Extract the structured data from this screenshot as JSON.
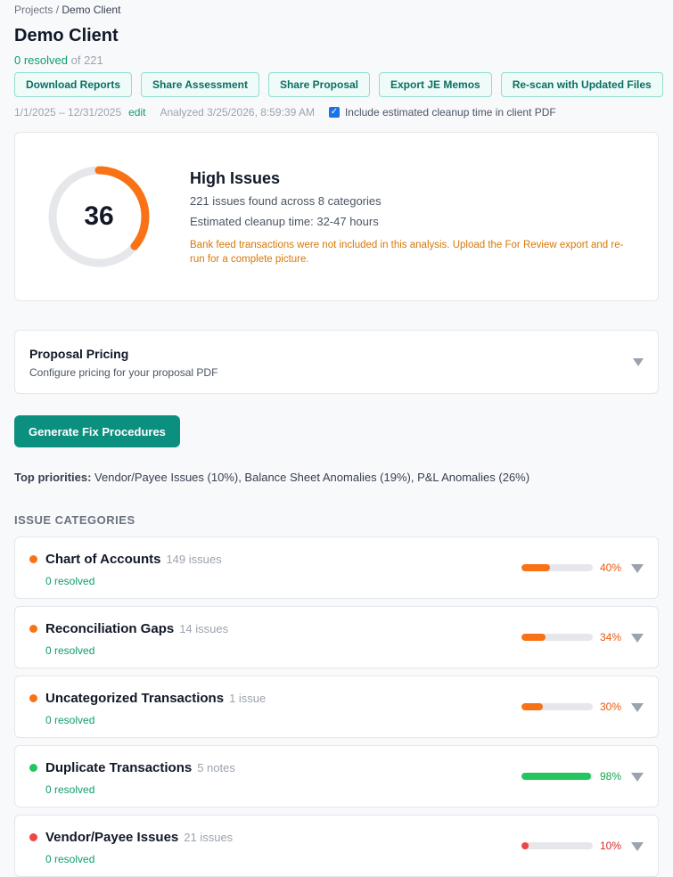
{
  "breadcrumb": {
    "root": "Projects",
    "separator": " / ",
    "current": "Demo Client"
  },
  "page": {
    "title": "Demo Client",
    "resolved_text": "0 resolved",
    "of_text": "of 221"
  },
  "actions": [
    {
      "label": "Download Reports",
      "name": "download-reports-button"
    },
    {
      "label": "Share Assessment",
      "name": "share-assessment-button"
    },
    {
      "label": "Share Proposal",
      "name": "share-proposal-button"
    },
    {
      "label": "Export JE Memos",
      "name": "export-je-memos-button"
    },
    {
      "label": "Re-scan with Updated Files",
      "name": "rescan-button"
    }
  ],
  "meta": {
    "date_range": "1/1/2025 – 12/31/2025",
    "edit_label": "edit",
    "analyzed": "Analyzed 3/25/2026, 8:59:39 AM",
    "include_checked": true,
    "include_label": "Include estimated cleanup time in client PDF"
  },
  "score": {
    "value": "36",
    "gauge_fraction": 0.36,
    "gauge_color": "#f97316",
    "title": "High Issues",
    "summary": "221 issues found across 8 categories",
    "cleanup": "Estimated cleanup time: 32-47 hours",
    "warning": "Bank feed transactions were not included in this analysis. Upload the For Review export and re-run for a complete picture."
  },
  "pricing": {
    "title": "Proposal Pricing",
    "subtitle": "Configure pricing for your proposal PDF"
  },
  "primary_button": "Generate Fix Procedures",
  "priorities": {
    "label": "Top priorities:",
    "text": " Vendor/Payee Issues (10%), Balance Sheet Anomalies (19%), P&L Anomalies (26%)"
  },
  "section_title": "ISSUE CATEGORIES",
  "categories": [
    {
      "name": "Chart of Accounts",
      "count": "149 issues",
      "resolved": "0 resolved",
      "percent": 40,
      "percent_label": "40%",
      "color": "#f97316",
      "text_color": "#ea580c"
    },
    {
      "name": "Reconciliation Gaps",
      "count": "14 issues",
      "resolved": "0 resolved",
      "percent": 34,
      "percent_label": "34%",
      "color": "#f97316",
      "text_color": "#ea580c"
    },
    {
      "name": "Uncategorized Transactions",
      "count": "1 issue",
      "resolved": "0 resolved",
      "percent": 30,
      "percent_label": "30%",
      "color": "#f97316",
      "text_color": "#ea580c"
    },
    {
      "name": "Duplicate Transactions",
      "count": "5 notes",
      "resolved": "0 resolved",
      "percent": 98,
      "percent_label": "98%",
      "color": "#22c55e",
      "text_color": "#16a34a"
    },
    {
      "name": "Vendor/Payee Issues",
      "count": "21 issues",
      "resolved": "0 resolved",
      "percent": 10,
      "percent_label": "10%",
      "color": "#ef4444",
      "text_color": "#dc2626"
    }
  ]
}
